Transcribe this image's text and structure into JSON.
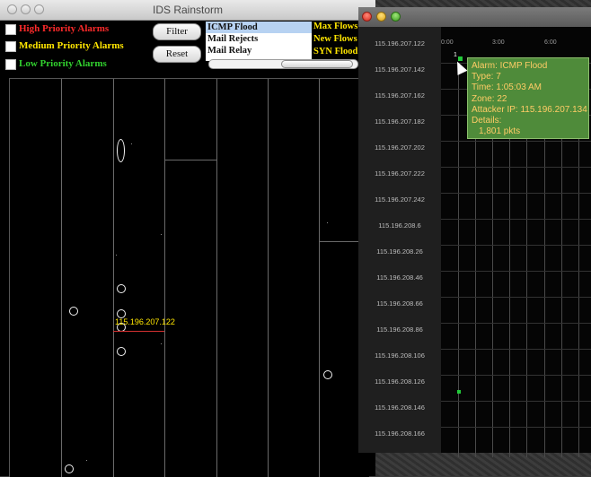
{
  "main_window": {
    "title": "IDS Rainstorm",
    "alarm_filters": [
      {
        "label": "High Priority Alarms",
        "color": "#ff2a2a"
      },
      {
        "label": "Medium Priority Alarms",
        "color": "#ffe600"
      },
      {
        "label": "Low Priority Alarms",
        "color": "#31d12e"
      }
    ],
    "buttons": {
      "filter": "Filter",
      "reset": "Reset"
    },
    "alarm_types": [
      {
        "label": "ICMP Flood",
        "selected": true
      },
      {
        "label": "Mail Rejects",
        "selected": false
      },
      {
        "label": "Mail Relay",
        "selected": false
      }
    ],
    "flow_types": [
      "Max Flows",
      "New Flows",
      "SYN Flood"
    ],
    "highlight_label": "115.196.207.122"
  },
  "detail_window": {
    "time_labels": [
      "0:00",
      "3:00",
      "6:00"
    ],
    "ip_rows": [
      "115.196.207.122",
      "115.196.207.142",
      "115.196.207.162",
      "115.196.207.182",
      "115.196.207.202",
      "115.196.207.222",
      "115.196.207.242",
      "115.196.208.6",
      "115.196.208.26",
      "115.196.208.46",
      "115.196.208.66",
      "115.196.208.86",
      "115.196.208.106",
      "115.196.208.126",
      "115.196.208.146",
      "115.196.208.166"
    ],
    "marker_label": "1",
    "tooltip": {
      "alarm": "Alarm: ICMP Flood",
      "type": "Type: 7",
      "time": "Time: 1:05:03 AM",
      "zone": "Zone: 22",
      "attacker": "Attacker IP: 115.196.207.134",
      "details": "Details:",
      "pkts": "1,801 pkts"
    }
  },
  "colors": {
    "accent_yellow": "#ffe600",
    "alarm_green": "#22c93a",
    "tooltip_bg": "#4f8b3a"
  }
}
